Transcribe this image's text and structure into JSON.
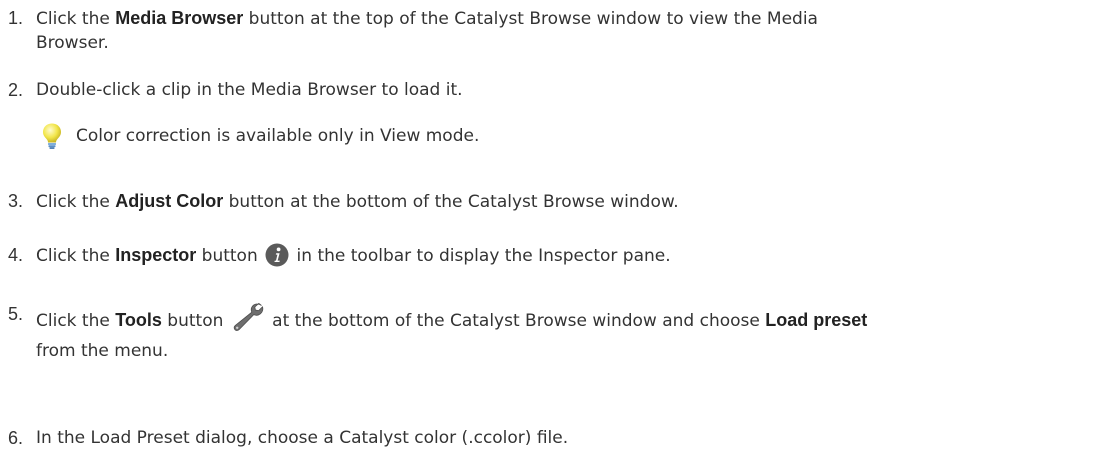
{
  "steps": [
    {
      "num": "1.",
      "pre": "Click the ",
      "bold": "Media Browser",
      "post": " button at the top of the Catalyst Browse window to view the Media",
      "line2": "Browser."
    },
    {
      "num": "2.",
      "text": "Double-click a clip in the Media Browser to load it."
    },
    {
      "num": "3.",
      "pre": "Click the ",
      "bold": "Adjust Color",
      "post": " button at the bottom of the Catalyst Browse window."
    },
    {
      "num": "4.",
      "pre": "Click the ",
      "bold": "Inspector",
      "mid": " button ",
      "icon": "info-icon",
      "post": " in the toolbar to display the Inspector pane."
    },
    {
      "num": "5.",
      "pre": "Click the ",
      "bold": "Tools",
      "mid": " button ",
      "icon": "wrench-icon",
      "post": "  at the bottom of the Catalyst Browse window and choose ",
      "bold2": "Load preset",
      "line2": "from the menu."
    },
    {
      "num": "6.",
      "text": "In the Load Preset dialog, choose a Catalyst color (.ccolor) file."
    }
  ],
  "note": {
    "icon": "lightbulb-icon",
    "text": "Color correction is available only in View mode."
  },
  "colors": {
    "text": "#333333",
    "bulb": "#f2e64a",
    "info_icon": "#5a5a5a",
    "wrench_icon": "#6a6a6a"
  }
}
